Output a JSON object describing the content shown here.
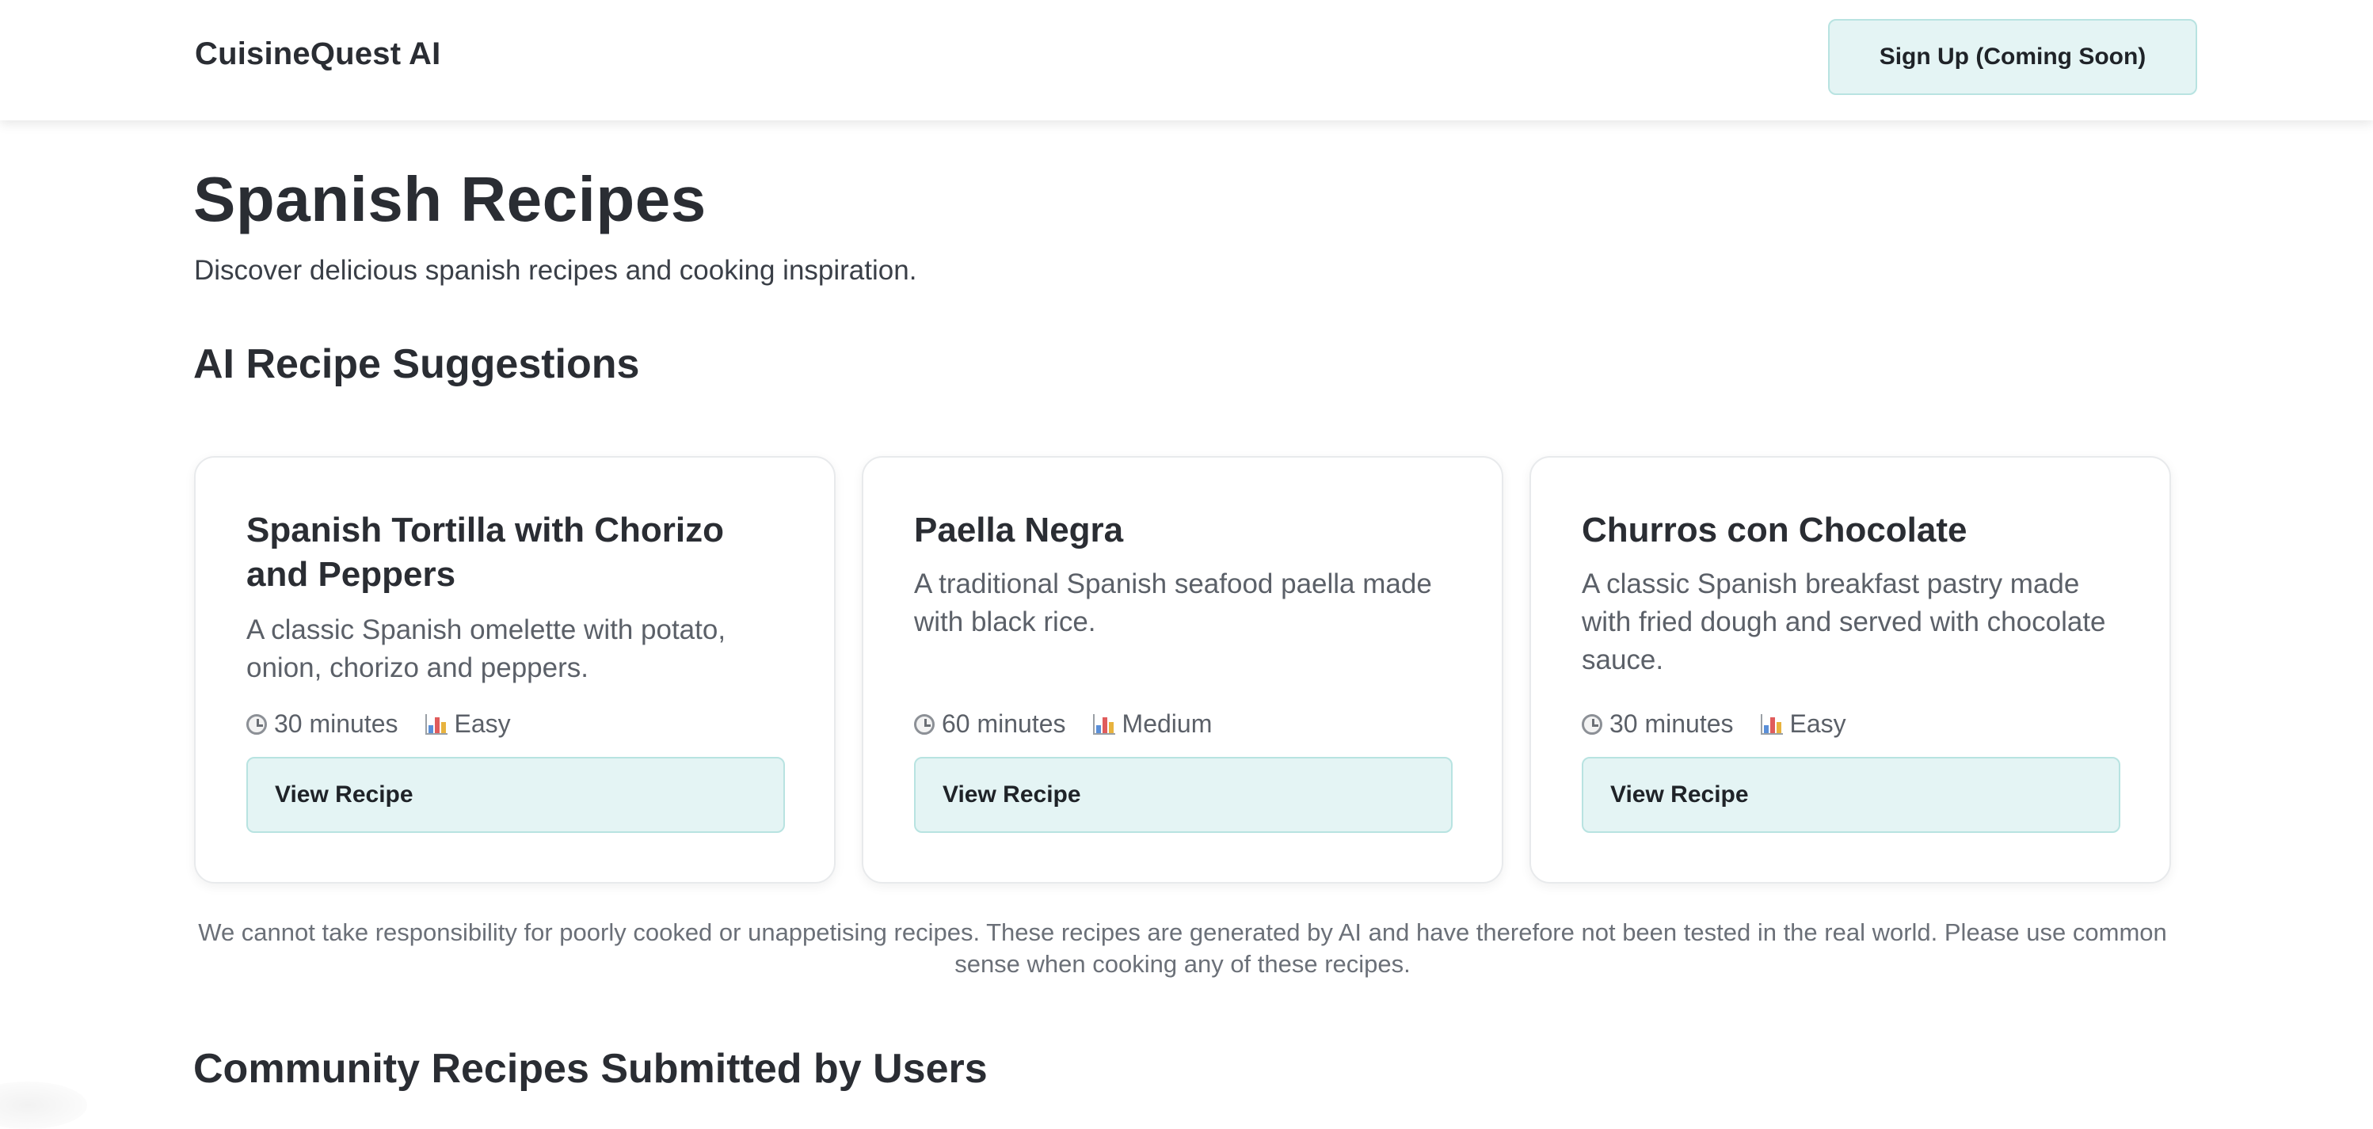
{
  "header": {
    "brand": "CuisineQuest AI",
    "signup_label": "Sign Up (Coming Soon)"
  },
  "page": {
    "title": "Spanish Recipes",
    "subtitle": "Discover delicious spanish recipes and cooking inspiration."
  },
  "sections": {
    "ai_title": "AI Recipe Suggestions",
    "community_title": "Community Recipes Submitted by Users"
  },
  "recipes": [
    {
      "title": "Spanish Tortilla with Chorizo and Peppers",
      "description": "A classic Spanish omelette with potato, onion, chorizo and peppers.",
      "time": "30 minutes",
      "difficulty": "Easy",
      "button_label": "View Recipe"
    },
    {
      "title": "Paella Negra",
      "description": "A traditional Spanish seafood paella made with black rice.",
      "time": "60 minutes",
      "difficulty": "Medium",
      "button_label": "View Recipe"
    },
    {
      "title": "Churros con Chocolate",
      "description": "A classic Spanish breakfast pastry made with fried dough and served with chocolate sauce.",
      "time": "30 minutes",
      "difficulty": "Easy",
      "button_label": "View Recipe"
    }
  ],
  "disclaimer": "We cannot take responsibility for poorly cooked or unappetising recipes. These recipes are generated by AI and have therefore not been tested in the real world. Please use common sense when cooking any of these recipes.",
  "colors": {
    "button_bg": "#e4f4f4",
    "button_border": "#b8e3e1",
    "text_dark": "#2a2d33",
    "text_muted": "#5b6068"
  },
  "icons": {
    "time": "clock-icon",
    "difficulty": "bar-chart-icon"
  }
}
